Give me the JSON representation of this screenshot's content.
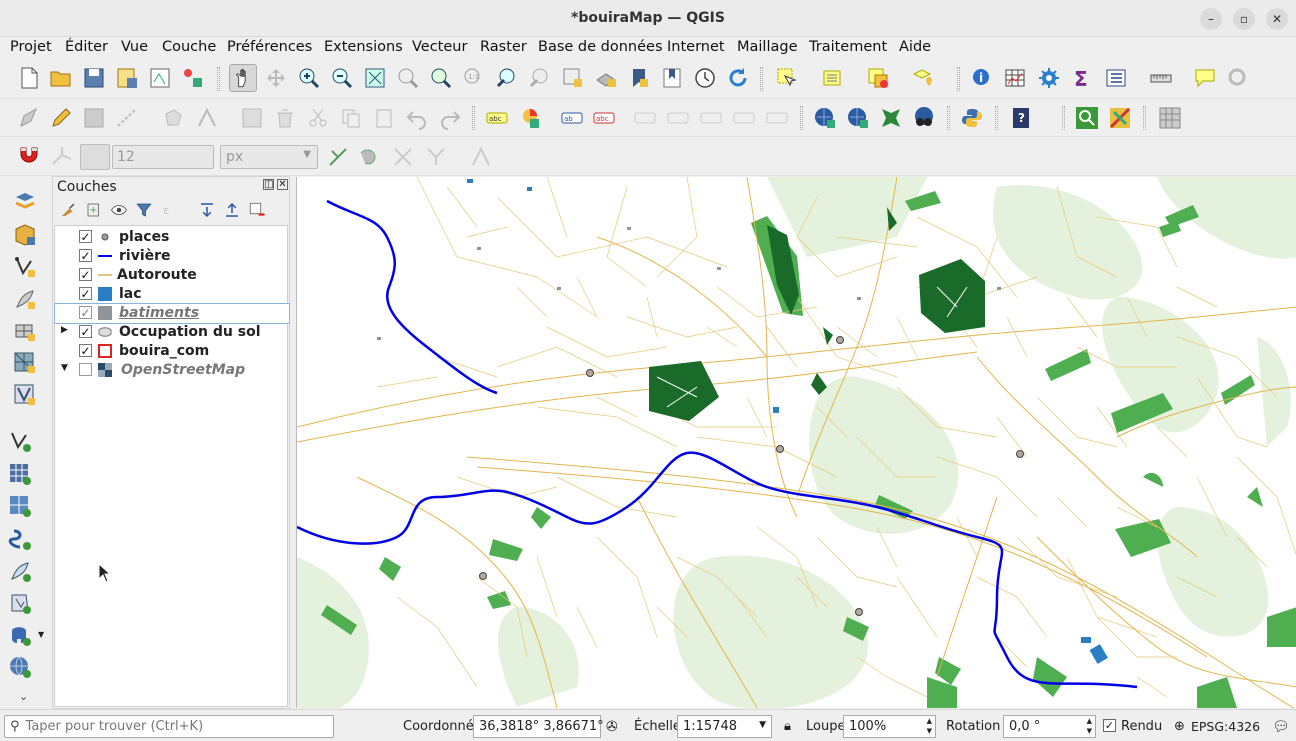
{
  "window": {
    "title": "*bouiraMap — QGIS"
  },
  "menu": [
    "Projet",
    "Éditer",
    "Vue",
    "Couche",
    "Préférences",
    "Extensions",
    "Vecteur",
    "Raster",
    "Base de données",
    "Internet",
    "Maillage",
    "Traitement",
    "Aide"
  ],
  "snapping": {
    "tolerance": "12",
    "unit": "px"
  },
  "layers_panel": {
    "title": "Couches",
    "layers": [
      {
        "name": "places",
        "checked": true,
        "symbol": "point"
      },
      {
        "name": "rivière",
        "checked": true,
        "symbol": "line-blue"
      },
      {
        "name": "Autoroute",
        "checked": true,
        "symbol": "line-orange"
      },
      {
        "name": "lac",
        "checked": true,
        "symbol": "fill-blue"
      },
      {
        "name": "batiments",
        "checked": true,
        "symbol": "fill-gray"
      },
      {
        "name": "Occupation du sol",
        "checked": true,
        "symbol": "group"
      },
      {
        "name": "bouira_com",
        "checked": true,
        "symbol": "outline-red"
      },
      {
        "name": "OpenStreetMap",
        "checked": false,
        "symbol": "raster"
      }
    ]
  },
  "status": {
    "search_placeholder": "Taper pour trouver (Ctrl+K)",
    "coord_label": "Coordonnée",
    "coord_value": "36,3818° 3,86671°",
    "scale_label": "Échelle",
    "scale_value": "1:15748",
    "magnifier_label": "Loupe",
    "magnifier_value": "100%",
    "rotation_label": "Rotation",
    "rotation_value": "0,0 °",
    "render_label": "Rendu",
    "crs": "EPSG:4326"
  },
  "colors": {
    "river": "#0000e6",
    "road": "#e2b54a",
    "forest": "#1a6b2a",
    "green": "#5cb85c",
    "lightgreen": "#e3f1dc"
  }
}
